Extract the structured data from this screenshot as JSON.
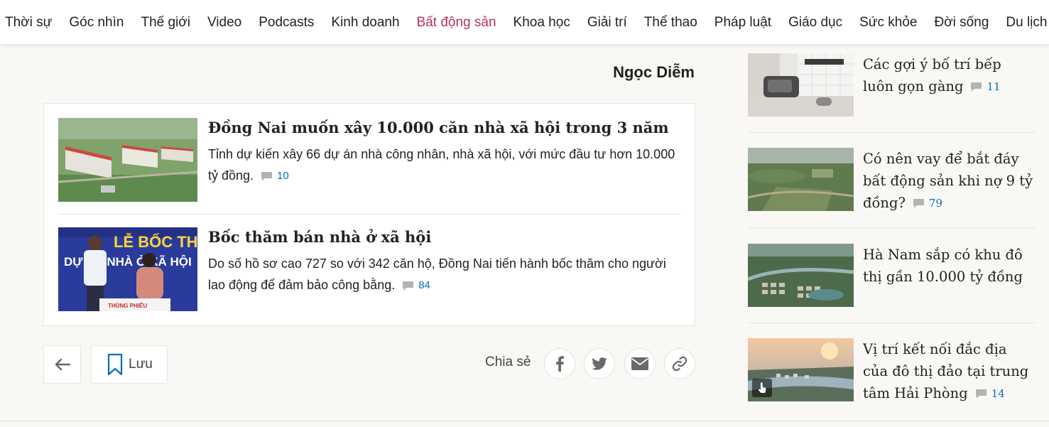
{
  "nav": {
    "items": [
      "Thời sự",
      "Góc nhìn",
      "Thế giới",
      "Video",
      "Podcasts",
      "Kinh doanh",
      "Bất động sản",
      "Khoa học",
      "Giải trí",
      "Thể thao",
      "Pháp luật",
      "Giáo dục",
      "Sức khỏe",
      "Đời sống",
      "Du lịch"
    ],
    "active_color": "#b5335f"
  },
  "article": {
    "author": "Ngọc Diễm"
  },
  "related": [
    {
      "title": "Đồng Nai muốn xây 10.000 căn nhà xã hội trong 3 năm",
      "desc": "Tỉnh dự kiến xây 66 dự án nhà công nhân, nhà xã hội, với mức đầu tư hơn 10.000 tỷ đồng.",
      "comments": "10"
    },
    {
      "title": "Bốc thăm bán nhà ở xã hội",
      "desc": "Do số hồ sơ cao 727 so với 342 căn hộ, Đồng Nai tiến hành bốc thăm cho người lao động để đảm bảo công bằng.",
      "comments": "84",
      "image_banner_text": "LỄ BỐC THĂM",
      "image_banner_text2": "DỰ ÁN NHÀ Ở XÃ HỘI",
      "image_box_text": "THÙNG PHIẾU"
    }
  ],
  "actions": {
    "save_label": "Lưu",
    "share_label": "Chia sẻ"
  },
  "sidebar": [
    {
      "title": "Các gợi ý bố trí bếp luôn gọn gàng",
      "comments": "11"
    },
    {
      "title": "Có nên vay để bắt đáy bất động sản khi nợ 9 tỷ đồng?",
      "comments": "79"
    },
    {
      "title": "Hà Nam sắp có khu đô thị gần 10.000 tỷ đồng",
      "comments": ""
    },
    {
      "title": "Vị trí kết nối đắc địa của đô thị đảo tại trung tâm Hải Phòng",
      "comments": "14"
    }
  ],
  "colors": {
    "comment_count": "#076db6",
    "background": "#f9f8f5"
  }
}
